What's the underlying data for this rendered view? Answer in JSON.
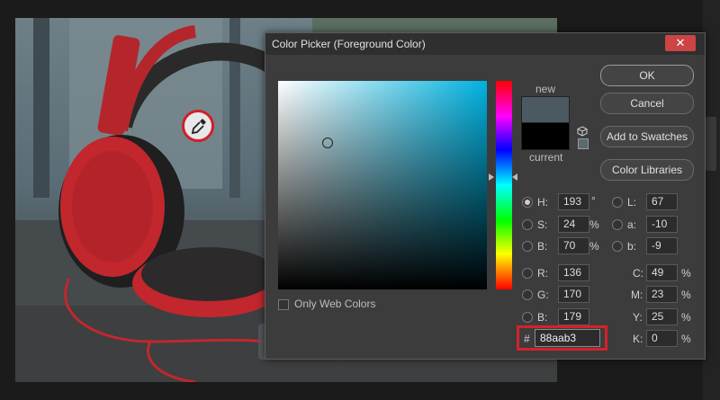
{
  "dialog": {
    "title": "Color Picker (Foreground Color)",
    "close": "✕",
    "new_label": "new",
    "current_label": "current",
    "new_color": "#4b5a61",
    "current_color": "#000000",
    "only_web_colors": "Only Web Colors",
    "buttons": {
      "ok": "OK",
      "cancel": "Cancel",
      "add_to_swatches": "Add to Swatches",
      "color_libraries": "Color Libraries"
    },
    "hsb": {
      "h_label": "H:",
      "h_value": "193",
      "h_unit": "°",
      "s_label": "S:",
      "s_value": "24",
      "s_unit": "%",
      "b_label": "B:",
      "b_value": "70",
      "b_unit": "%"
    },
    "lab": {
      "l_label": "L:",
      "l_value": "67",
      "a_label": "a:",
      "a_value": "-10",
      "b_label": "b:",
      "b_value": "-9"
    },
    "rgb": {
      "r_label": "R:",
      "r_value": "136",
      "g_label": "G:",
      "g_value": "170",
      "b_label": "B:",
      "b_value": "179"
    },
    "cmyk": {
      "c_label": "C:",
      "c_value": "49",
      "c_unit": "%",
      "m_label": "M:",
      "m_value": "23",
      "m_unit": "%",
      "y_label": "Y:",
      "y_value": "25",
      "y_unit": "%",
      "k_label": "K:",
      "k_value": "0",
      "k_unit": "%"
    },
    "hex": {
      "hash": "#",
      "value": "88aab3"
    },
    "selected_mode": "H"
  },
  "colors": {
    "highlight": "#d3222c",
    "headphones": "#c1272d",
    "dialog_bg": "#3c3c3c"
  }
}
